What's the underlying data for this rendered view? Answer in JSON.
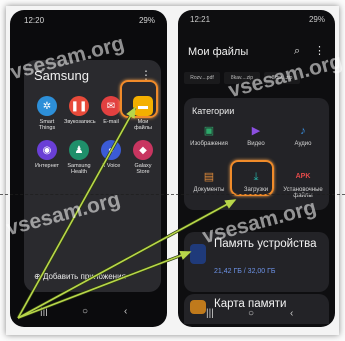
{
  "left_phone": {
    "status_time": "12:20",
    "status_right": "29%",
    "folder_title": "Samsung",
    "apps": [
      {
        "label": "Smart Things",
        "color": "#2d8fd8"
      },
      {
        "label": "Звукозапись",
        "color": "#e84a3a"
      },
      {
        "label": "E-mail",
        "color": "#e24040"
      },
      {
        "label": "Мои файлы",
        "color": "#f4b000"
      },
      {
        "label": "Интернет",
        "color": "#6a3fd6"
      },
      {
        "label": "Samsung Health",
        "color": "#1f8f6a"
      },
      {
        "label": "S Voice",
        "color": "#3b5bd6"
      },
      {
        "label": "Galaxy Store",
        "color": "#c83560"
      }
    ],
    "add_apps": "Добавить приложения"
  },
  "right_phone": {
    "status_time": "12:21",
    "status_right": "29%",
    "title": "Мои файлы",
    "recent_files": [
      "Rozv....pdf",
      "8kav....zip",
      "8kav...zip"
    ],
    "categories_title": "Категории",
    "categories": [
      {
        "label": "Изображения",
        "color": "#2da86a"
      },
      {
        "label": "Видео",
        "color": "#8b4fe0"
      },
      {
        "label": "Аудио",
        "color": "#3a8fe0"
      },
      {
        "label": "Документы",
        "color": "#e08b3a"
      },
      {
        "label": "Загрузки",
        "color": "#27b3a8"
      },
      {
        "label": "Установочные файлы",
        "color": "#e24a4a"
      }
    ],
    "apk_label": "APK",
    "storage_title": "Память устройства",
    "storage_size": "21,42 ГБ / 32,00 ГБ",
    "card_title": "Карта памяти"
  },
  "watermark": "vsesam.org",
  "highlight_color": "#f08b2a"
}
